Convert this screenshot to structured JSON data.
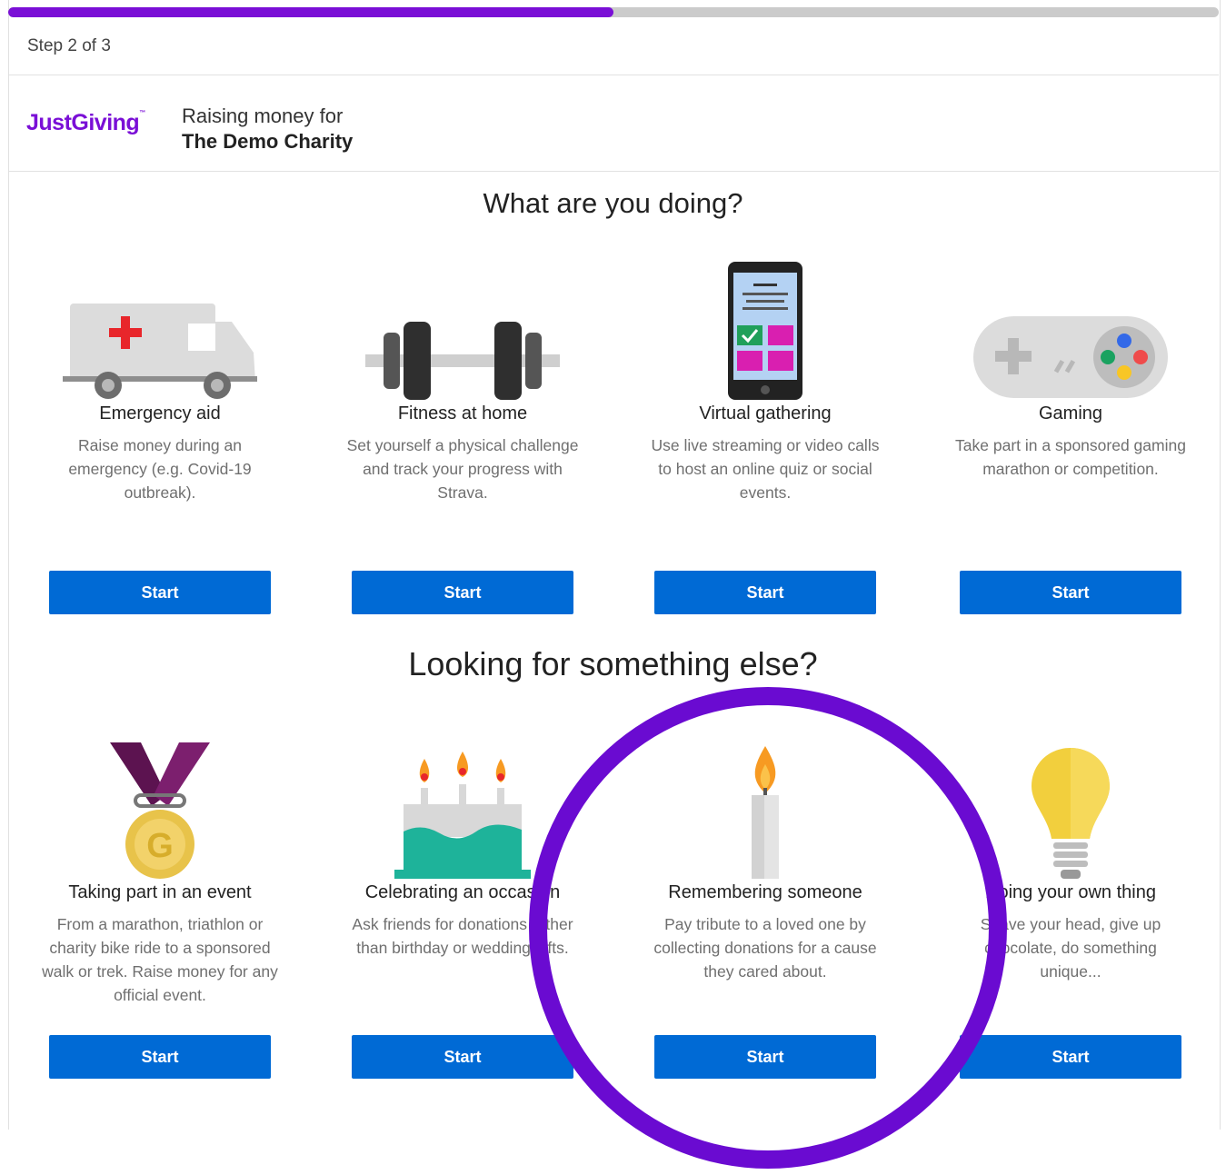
{
  "progress": {
    "label": "Step 2 of 3",
    "fraction": 0.5
  },
  "brand": {
    "logo_text": "JustGiving",
    "raising_label": "Raising money for",
    "charity_name": "The Demo Charity"
  },
  "section1": {
    "title": "What are you doing?",
    "cards": [
      {
        "title": "Emergency aid",
        "desc": "Raise money during an emergency (e.g. Covid-19 outbreak).",
        "button": "Start",
        "icon": "ambulance-icon"
      },
      {
        "title": "Fitness at home",
        "desc": "Set yourself a physical challenge and track your progress with Strava.",
        "button": "Start",
        "icon": "dumbbell-icon"
      },
      {
        "title": "Virtual gathering",
        "desc": "Use live streaming or video calls to host an online quiz or social events.",
        "button": "Start",
        "icon": "smartphone-icon"
      },
      {
        "title": "Gaming",
        "desc": "Take part in a sponsored gaming marathon or competition.",
        "button": "Start",
        "icon": "game-controller-icon"
      }
    ]
  },
  "section2": {
    "title": "Looking for something else?",
    "cards": [
      {
        "title": "Taking part in an event",
        "desc": "From a marathon, triathlon or charity bike ride to a sponsored walk or trek. Raise money for any official event.",
        "button": "Start",
        "icon": "medal-icon"
      },
      {
        "title": "Celebrating an occasion",
        "desc": "Ask friends for donations rather than birthday or wedding gifts.",
        "button": "Start",
        "icon": "birthday-cake-icon"
      },
      {
        "title": "Remembering someone",
        "desc": "Pay tribute to a loved one by collecting donations for a cause they cared about.",
        "button": "Start",
        "icon": "candle-icon"
      },
      {
        "title": "Doing your own thing",
        "desc": "Shave your head, give up chocolate, do something unique...",
        "button": "Start",
        "icon": "lightbulb-icon"
      }
    ]
  },
  "colors": {
    "accent": "#7a0fd6",
    "button": "#006ad5",
    "highlight": "#6a0bd1"
  }
}
